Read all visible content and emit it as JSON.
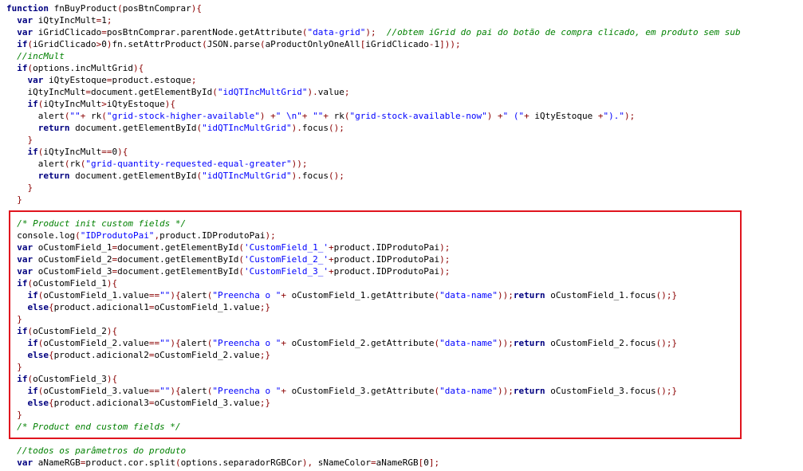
{
  "colors": {
    "keyword": "#000080",
    "string": "#0000ff",
    "operator": "#8b0000",
    "comment": "#008000",
    "highlight_border": "#e0141e",
    "background": "#ffffff"
  },
  "lines": [
    [
      [
        "kw",
        "function"
      ],
      [
        "pl",
        " fnBuyProduct"
      ],
      [
        "op",
        "("
      ],
      [
        "pl",
        "posBtnComprar"
      ],
      [
        "op",
        ")"
      ],
      [
        "op",
        "{"
      ]
    ],
    [
      [
        "pl",
        "  "
      ],
      [
        "kw",
        "var"
      ],
      [
        "pl",
        " iQtyIncMult"
      ],
      [
        "op",
        "="
      ],
      [
        "pl",
        "1"
      ],
      [
        "op",
        ";"
      ]
    ],
    [
      [
        "pl",
        "  "
      ],
      [
        "kw",
        "var"
      ],
      [
        "pl",
        " iGridClicado"
      ],
      [
        "op",
        "="
      ],
      [
        "pl",
        "posBtnComprar.parentNode.getAttribute"
      ],
      [
        "op",
        "("
      ],
      [
        "str",
        "\"data-grid\""
      ],
      [
        "op",
        ");"
      ],
      [
        "pl",
        "  "
      ],
      [
        "cm",
        "//obtem iGrid do pai do botão de compra clicado, em produto sem sub"
      ]
    ],
    [
      [
        "pl",
        "  "
      ],
      [
        "kw",
        "if"
      ],
      [
        "op",
        "("
      ],
      [
        "pl",
        "iGridClicado"
      ],
      [
        "op",
        ">"
      ],
      [
        "pl",
        "0"
      ],
      [
        "op",
        ")"
      ],
      [
        "pl",
        "fn.setAttrProduct"
      ],
      [
        "op",
        "("
      ],
      [
        "pl",
        "JSON.parse"
      ],
      [
        "op",
        "("
      ],
      [
        "pl",
        "aProductOnlyOneAll"
      ],
      [
        "op",
        "["
      ],
      [
        "pl",
        "iGridClicado"
      ],
      [
        "op",
        "-"
      ],
      [
        "pl",
        "1"
      ],
      [
        "op",
        "]));"
      ]
    ],
    [
      [
        "pl",
        "  "
      ],
      [
        "cm",
        "//incMult"
      ]
    ],
    [
      [
        "pl",
        "  "
      ],
      [
        "kw",
        "if"
      ],
      [
        "op",
        "("
      ],
      [
        "pl",
        "options.incMultGrid"
      ],
      [
        "op",
        "){"
      ]
    ],
    [
      [
        "pl",
        "    "
      ],
      [
        "kw",
        "var"
      ],
      [
        "pl",
        " iQtyEstoque"
      ],
      [
        "op",
        "="
      ],
      [
        "pl",
        "product.estoque"
      ],
      [
        "op",
        ";"
      ]
    ],
    [
      [
        "pl",
        "    iQtyIncMult"
      ],
      [
        "op",
        "="
      ],
      [
        "pl",
        "document.getElementById"
      ],
      [
        "op",
        "("
      ],
      [
        "str",
        "\"idQTIncMultGrid\""
      ],
      [
        "op",
        ")."
      ],
      [
        "pl",
        "value"
      ],
      [
        "op",
        ";"
      ]
    ],
    [
      [
        "pl",
        "    "
      ],
      [
        "kw",
        "if"
      ],
      [
        "op",
        "("
      ],
      [
        "pl",
        "iQtyIncMult"
      ],
      [
        "op",
        ">"
      ],
      [
        "pl",
        "iQtyEstoque"
      ],
      [
        "op",
        "){"
      ]
    ],
    [
      [
        "pl",
        "      alert"
      ],
      [
        "op",
        "("
      ],
      [
        "str",
        "\"\""
      ],
      [
        "op",
        "+"
      ],
      [
        "pl",
        " rk"
      ],
      [
        "op",
        "("
      ],
      [
        "str",
        "\"grid-stock-higher-available\""
      ],
      [
        "op",
        ")"
      ],
      [
        "pl",
        " "
      ],
      [
        "op",
        "+"
      ],
      [
        "str",
        "\" \\n\""
      ],
      [
        "op",
        "+"
      ],
      [
        "pl",
        " "
      ],
      [
        "str",
        "\"\""
      ],
      [
        "op",
        "+"
      ],
      [
        "pl",
        " rk"
      ],
      [
        "op",
        "("
      ],
      [
        "str",
        "\"grid-stock-available-now\""
      ],
      [
        "op",
        ")"
      ],
      [
        "pl",
        " "
      ],
      [
        "op",
        "+"
      ],
      [
        "str",
        "\" (\""
      ],
      [
        "op",
        "+"
      ],
      [
        "pl",
        " iQtyEstoque "
      ],
      [
        "op",
        "+"
      ],
      [
        "str",
        "\").\""
      ],
      [
        "op",
        ");"
      ]
    ],
    [
      [
        "pl",
        "      "
      ],
      [
        "kw",
        "return"
      ],
      [
        "pl",
        " document.getElementById"
      ],
      [
        "op",
        "("
      ],
      [
        "str",
        "\"idQTIncMultGrid\""
      ],
      [
        "op",
        ")."
      ],
      [
        "pl",
        "focus"
      ],
      [
        "op",
        "();"
      ]
    ],
    [
      [
        "pl",
        "    "
      ],
      [
        "op",
        "}"
      ]
    ],
    [
      [
        "pl",
        "    "
      ],
      [
        "kw",
        "if"
      ],
      [
        "op",
        "("
      ],
      [
        "pl",
        "iQtyIncMult"
      ],
      [
        "op",
        "=="
      ],
      [
        "pl",
        "0"
      ],
      [
        "op",
        "){"
      ]
    ],
    [
      [
        "pl",
        "      alert"
      ],
      [
        "op",
        "("
      ],
      [
        "pl",
        "rk"
      ],
      [
        "op",
        "("
      ],
      [
        "str",
        "\"grid-quantity-requested-equal-greater\""
      ],
      [
        "op",
        "));"
      ]
    ],
    [
      [
        "pl",
        "      "
      ],
      [
        "kw",
        "return"
      ],
      [
        "pl",
        " document.getElementById"
      ],
      [
        "op",
        "("
      ],
      [
        "str",
        "\"idQTIncMultGrid\""
      ],
      [
        "op",
        ")."
      ],
      [
        "pl",
        "focus"
      ],
      [
        "op",
        "();"
      ]
    ],
    [
      [
        "pl",
        "    "
      ],
      [
        "op",
        "}"
      ]
    ],
    [
      [
        "pl",
        "  "
      ],
      [
        "op",
        "}"
      ]
    ],
    [],
    [
      [
        "pl",
        "  "
      ],
      [
        "cm",
        "/* Product init custom fields */"
      ]
    ],
    [
      [
        "pl",
        "  console.log"
      ],
      [
        "op",
        "("
      ],
      [
        "str",
        "\"IDProdutoPai\""
      ],
      [
        "op",
        ","
      ],
      [
        "pl",
        "product.IDProdutoPai"
      ],
      [
        "op",
        ");"
      ]
    ],
    [
      [
        "pl",
        "  "
      ],
      [
        "kw",
        "var"
      ],
      [
        "pl",
        " oCustomField_1"
      ],
      [
        "op",
        "="
      ],
      [
        "pl",
        "document.getElementById"
      ],
      [
        "op",
        "("
      ],
      [
        "str",
        "'CustomField_1_'"
      ],
      [
        "op",
        "+"
      ],
      [
        "pl",
        "product.IDProdutoPai"
      ],
      [
        "op",
        ");"
      ]
    ],
    [
      [
        "pl",
        "  "
      ],
      [
        "kw",
        "var"
      ],
      [
        "pl",
        " oCustomField_2"
      ],
      [
        "op",
        "="
      ],
      [
        "pl",
        "document.getElementById"
      ],
      [
        "op",
        "("
      ],
      [
        "str",
        "'CustomField_2_'"
      ],
      [
        "op",
        "+"
      ],
      [
        "pl",
        "product.IDProdutoPai"
      ],
      [
        "op",
        ");"
      ]
    ],
    [
      [
        "pl",
        "  "
      ],
      [
        "kw",
        "var"
      ],
      [
        "pl",
        " oCustomField_3"
      ],
      [
        "op",
        "="
      ],
      [
        "pl",
        "document.getElementById"
      ],
      [
        "op",
        "("
      ],
      [
        "str",
        "'CustomField_3_'"
      ],
      [
        "op",
        "+"
      ],
      [
        "pl",
        "product.IDProdutoPai"
      ],
      [
        "op",
        ");"
      ]
    ],
    [
      [
        "pl",
        "  "
      ],
      [
        "kw",
        "if"
      ],
      [
        "op",
        "("
      ],
      [
        "pl",
        "oCustomField_1"
      ],
      [
        "op",
        "){"
      ]
    ],
    [
      [
        "pl",
        "    "
      ],
      [
        "kw",
        "if"
      ],
      [
        "op",
        "("
      ],
      [
        "pl",
        "oCustomField_1.value"
      ],
      [
        "op",
        "=="
      ],
      [
        "str",
        "\"\""
      ],
      [
        "op",
        "){"
      ],
      [
        "pl",
        "alert"
      ],
      [
        "op",
        "("
      ],
      [
        "str",
        "\"Preencha o \""
      ],
      [
        "op",
        "+"
      ],
      [
        "pl",
        " oCustomField_1.getAttribute"
      ],
      [
        "op",
        "("
      ],
      [
        "str",
        "\"data-name\""
      ],
      [
        "op",
        "));"
      ],
      [
        "kw",
        "return"
      ],
      [
        "pl",
        " oCustomField_1.focus"
      ],
      [
        "op",
        "();}"
      ]
    ],
    [
      [
        "pl",
        "    "
      ],
      [
        "kw",
        "else"
      ],
      [
        "op",
        "{"
      ],
      [
        "pl",
        "product.adicional1"
      ],
      [
        "op",
        "="
      ],
      [
        "pl",
        "oCustomField_1.value"
      ],
      [
        "op",
        ";}"
      ]
    ],
    [
      [
        "pl",
        "  "
      ],
      [
        "op",
        "}"
      ]
    ],
    [
      [
        "pl",
        "  "
      ],
      [
        "kw",
        "if"
      ],
      [
        "op",
        "("
      ],
      [
        "pl",
        "oCustomField_2"
      ],
      [
        "op",
        "){"
      ]
    ],
    [
      [
        "pl",
        "    "
      ],
      [
        "kw",
        "if"
      ],
      [
        "op",
        "("
      ],
      [
        "pl",
        "oCustomField_2.value"
      ],
      [
        "op",
        "=="
      ],
      [
        "str",
        "\"\""
      ],
      [
        "op",
        "){"
      ],
      [
        "pl",
        "alert"
      ],
      [
        "op",
        "("
      ],
      [
        "str",
        "\"Preencha o \""
      ],
      [
        "op",
        "+"
      ],
      [
        "pl",
        " oCustomField_2.getAttribute"
      ],
      [
        "op",
        "("
      ],
      [
        "str",
        "\"data-name\""
      ],
      [
        "op",
        "));"
      ],
      [
        "kw",
        "return"
      ],
      [
        "pl",
        " oCustomField_2.focus"
      ],
      [
        "op",
        "();}"
      ]
    ],
    [
      [
        "pl",
        "    "
      ],
      [
        "kw",
        "else"
      ],
      [
        "op",
        "{"
      ],
      [
        "pl",
        "product.adicional2"
      ],
      [
        "op",
        "="
      ],
      [
        "pl",
        "oCustomField_2.value"
      ],
      [
        "op",
        ";}"
      ]
    ],
    [
      [
        "pl",
        "  "
      ],
      [
        "op",
        "}"
      ]
    ],
    [
      [
        "pl",
        "  "
      ],
      [
        "kw",
        "if"
      ],
      [
        "op",
        "("
      ],
      [
        "pl",
        "oCustomField_3"
      ],
      [
        "op",
        "){"
      ]
    ],
    [
      [
        "pl",
        "    "
      ],
      [
        "kw",
        "if"
      ],
      [
        "op",
        "("
      ],
      [
        "pl",
        "oCustomField_3.value"
      ],
      [
        "op",
        "=="
      ],
      [
        "str",
        "\"\""
      ],
      [
        "op",
        "){"
      ],
      [
        "pl",
        "alert"
      ],
      [
        "op",
        "("
      ],
      [
        "str",
        "\"Preencha o \""
      ],
      [
        "op",
        "+"
      ],
      [
        "pl",
        " oCustomField_3.getAttribute"
      ],
      [
        "op",
        "("
      ],
      [
        "str",
        "\"data-name\""
      ],
      [
        "op",
        "));"
      ],
      [
        "kw",
        "return"
      ],
      [
        "pl",
        " oCustomField_3.focus"
      ],
      [
        "op",
        "();}"
      ]
    ],
    [
      [
        "pl",
        "    "
      ],
      [
        "kw",
        "else"
      ],
      [
        "op",
        "{"
      ],
      [
        "pl",
        "product.adicional3"
      ],
      [
        "op",
        "="
      ],
      [
        "pl",
        "oCustomField_3.value"
      ],
      [
        "op",
        ";}"
      ]
    ],
    [
      [
        "pl",
        "  "
      ],
      [
        "op",
        "}"
      ]
    ],
    [
      [
        "pl",
        "  "
      ],
      [
        "cm",
        "/* Product end custom fields */"
      ]
    ],
    [],
    [
      [
        "pl",
        "  "
      ],
      [
        "cm",
        "//todos os parâmetros do produto"
      ]
    ],
    [
      [
        "pl",
        "  "
      ],
      [
        "kw",
        "var"
      ],
      [
        "pl",
        " aNameRGB"
      ],
      [
        "op",
        "="
      ],
      [
        "pl",
        "product.cor.split"
      ],
      [
        "op",
        "("
      ],
      [
        "pl",
        "options.separadorRGBCor"
      ],
      [
        "op",
        "),"
      ],
      [
        "pl",
        " sNameColor"
      ],
      [
        "op",
        "="
      ],
      [
        "pl",
        "aNameRGB"
      ],
      [
        "op",
        "["
      ],
      [
        "pl",
        "0"
      ],
      [
        "op",
        "];"
      ]
    ]
  ]
}
